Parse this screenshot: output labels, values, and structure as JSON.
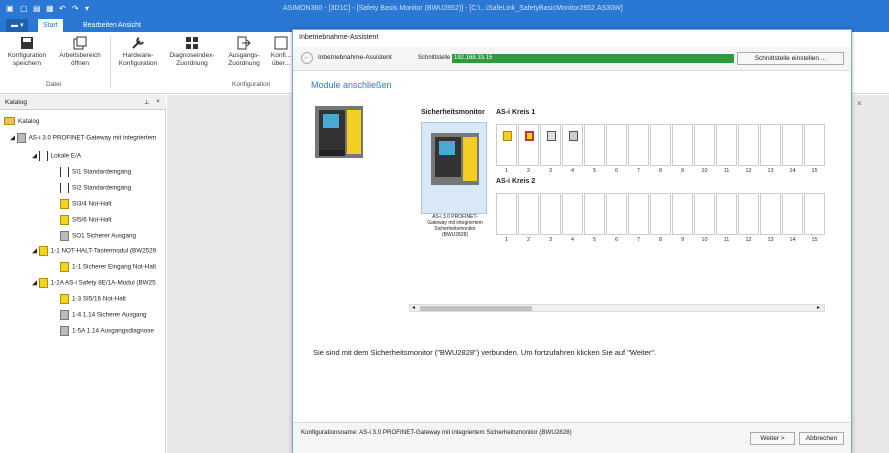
{
  "window": {
    "title": "ASIMON360 - [3D1C] - [Safety Basis Monitor (BWU2852)] - [C:\\...\\SafeLink_SafetyBasicMonitor2852.AS30W]"
  },
  "ribbon": {
    "tabs": [
      "Start",
      "Bearbeiten",
      "Ansicht"
    ],
    "buttons": {
      "konfig": "Konfiguration speichern",
      "arbeitsbereich": "Arbeitsbereich öffnen",
      "hardware": "Hardware-Konfiguration",
      "diagnose": "Diagnoseindex-Zuordnung",
      "ausgang": "Ausgangs-Zuordnung",
      "konfig2": "Konfi... über..."
    },
    "groups": {
      "datei": "Datei",
      "konfiguration": "Konfiguration"
    }
  },
  "catalog": {
    "header": "Katalog",
    "items": [
      {
        "label": "Katalog",
        "icon": "folder-icon"
      },
      {
        "label": "AS-i 3.0 PROFINET-Gateway mit integriertem",
        "icon": "gateway-icon"
      },
      {
        "label": "Lokale E/A",
        "icon": "switch-icon"
      },
      {
        "label": "SI1 Standardeingang",
        "icon": "switch-icon"
      },
      {
        "label": "SI2 Standardeingang",
        "icon": "switch-icon"
      },
      {
        "label": "SI3/4 Not-Halt",
        "icon": "estop-icon"
      },
      {
        "label": "SI5/6 Not-Halt",
        "icon": "estop-icon"
      },
      {
        "label": "SO1 Sicherer Ausgang",
        "icon": "output-icon"
      },
      {
        "label": "1-1 NOT-HALT-Tastermodul (BW2529",
        "icon": "estop-icon"
      },
      {
        "label": "1-1 Sicherer Eingang Not-Halt",
        "icon": "estop-icon"
      },
      {
        "label": "1-2A AS-i Safety 8E/1A-Modul (BW25",
        "icon": "module-icon"
      },
      {
        "label": "1-3 SI5/16 Not-Halt",
        "icon": "estop-icon"
      },
      {
        "label": "1-4 1.14 Sicherer Ausgang",
        "icon": "output-icon"
      },
      {
        "label": "1-5A 1.14 Ausgangsdiagnose",
        "icon": "output-icon"
      }
    ]
  },
  "dialog": {
    "title": "Inbetriebnahme-Assistent",
    "nav_title": "Inbetriebnahme-Assistent",
    "interface_label": "Schnittstelle",
    "interface_value": "192.168.33.15",
    "interface_button": "Schnittstelle einstellen ...",
    "heading": "Module anschließen",
    "monitor_label": "Sicherheitsmonitor",
    "monitor_caption": "AS-i 3.0 PROFINET-Gateway mit integriertem Sicherheitsmonitor (BWU2828)",
    "kreis1": "AS-i Kreis 1",
    "kreis2": "AS-i Kreis 2",
    "slot_numbers": [
      "1",
      "2",
      "3",
      "4",
      "5",
      "6",
      "7",
      "8",
      "9",
      "10",
      "11",
      "12",
      "13",
      "14",
      "15"
    ],
    "message": "Sie sind mit dem Sicherheitsmonitor (\"BWU2828\") verbunden. Um fortzufahren klicken Sie auf \"Weiter\".",
    "config_name": "Konfigurationsname: AS-i 3.0 PROFINET-Gateway mit integriertem Sicherheitsmonitor (BWU2828)",
    "next_button": "Weiter >",
    "cancel_button": "Abbrechen"
  }
}
